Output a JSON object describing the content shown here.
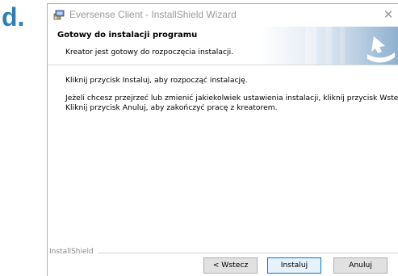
{
  "step_marker": "d.",
  "window": {
    "title": "Eversense Client - InstallShield Wizard",
    "close_glyph": "✕"
  },
  "banner": {
    "heading": "Gotowy do instalacji programu",
    "subheading": "Kreator jest gotowy do rozpoczęcia instalacji."
  },
  "body": {
    "line1": "Kliknij przycisk Instaluj, aby rozpocząć instalację.",
    "line2": "Jeżeli chcesz przejrzeć lub zmienić jakiekolwiek ustawienia instalacji, kliknij przycisk Wstecz.",
    "line3": "Kliknij przycisk Anuluj, aby zakończyć pracę z kreatorem."
  },
  "footer": {
    "brand": "InstallShield"
  },
  "buttons": {
    "back": "< Wstecz",
    "install": "Instaluj",
    "cancel": "Anuluj"
  },
  "colors": {
    "accent": "#2b7fb6",
    "primary_border": "#0078d7"
  }
}
